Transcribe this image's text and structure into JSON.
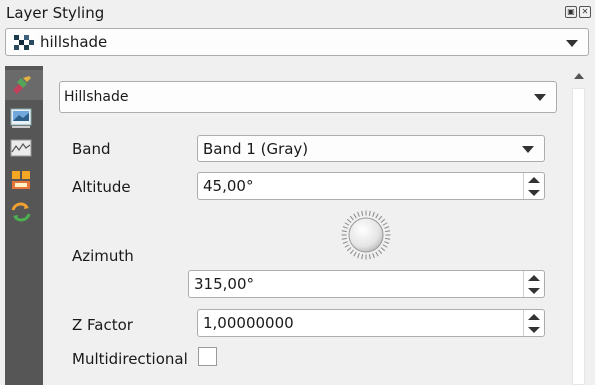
{
  "panel": {
    "title": "Layer Styling",
    "float_icon": "float-icon",
    "close_icon": "close-icon"
  },
  "layer_selector": {
    "value": "hillshade",
    "icon": "raster-layer-icon"
  },
  "sidebar": {
    "items": [
      {
        "name": "symbology",
        "icon": "paintbrush-icon",
        "active": true
      },
      {
        "name": "transparency",
        "icon": "image-icon"
      },
      {
        "name": "histogram",
        "icon": "histogram-icon"
      },
      {
        "name": "labels",
        "icon": "labels-icon"
      },
      {
        "name": "history",
        "icon": "history-icon"
      }
    ]
  },
  "renderer": {
    "selected": "Hillshade"
  },
  "form": {
    "band_label": "Band",
    "band_value": "Band 1 (Gray)",
    "altitude_label": "Altitude",
    "altitude_value": "45,00°",
    "azimuth_label": "Azimuth",
    "azimuth_value": "315,00°",
    "zfactor_label": "Z Factor",
    "zfactor_value": "1,00000000",
    "multidirectional_label": "Multidirectional",
    "multidirectional_checked": false
  },
  "colors": {
    "sidebar_bg": "#565656",
    "panel_bg": "#f0f0f0",
    "field_border": "#adadad"
  }
}
